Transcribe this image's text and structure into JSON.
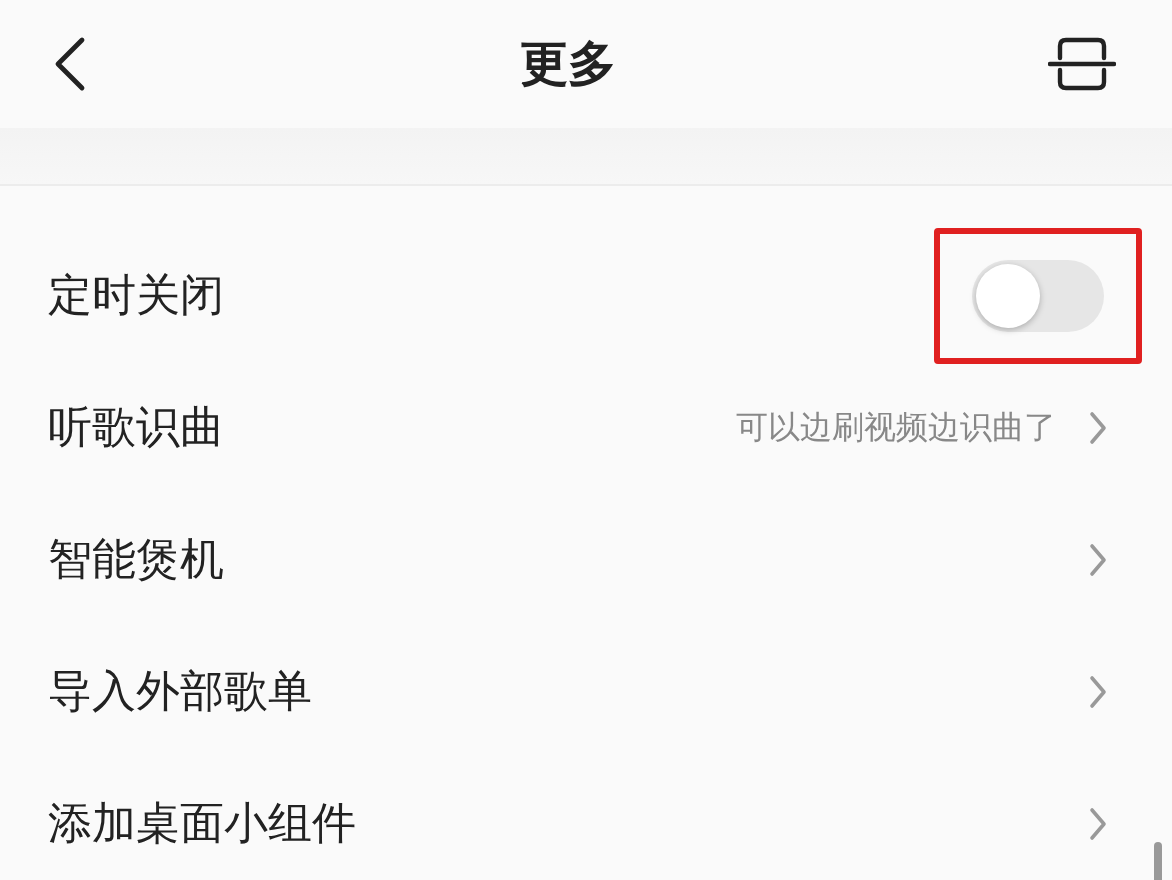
{
  "header": {
    "title": "更多"
  },
  "rows": [
    {
      "kind": "toggle",
      "label": "定时关闭",
      "on": false,
      "highlighted": true
    },
    {
      "kind": "link",
      "label": "听歌识曲",
      "hint": "可以边刷视频边识曲了"
    },
    {
      "kind": "link",
      "label": "智能煲机"
    },
    {
      "kind": "link",
      "label": "导入外部歌单"
    },
    {
      "kind": "link",
      "label": "添加桌面小组件"
    }
  ]
}
